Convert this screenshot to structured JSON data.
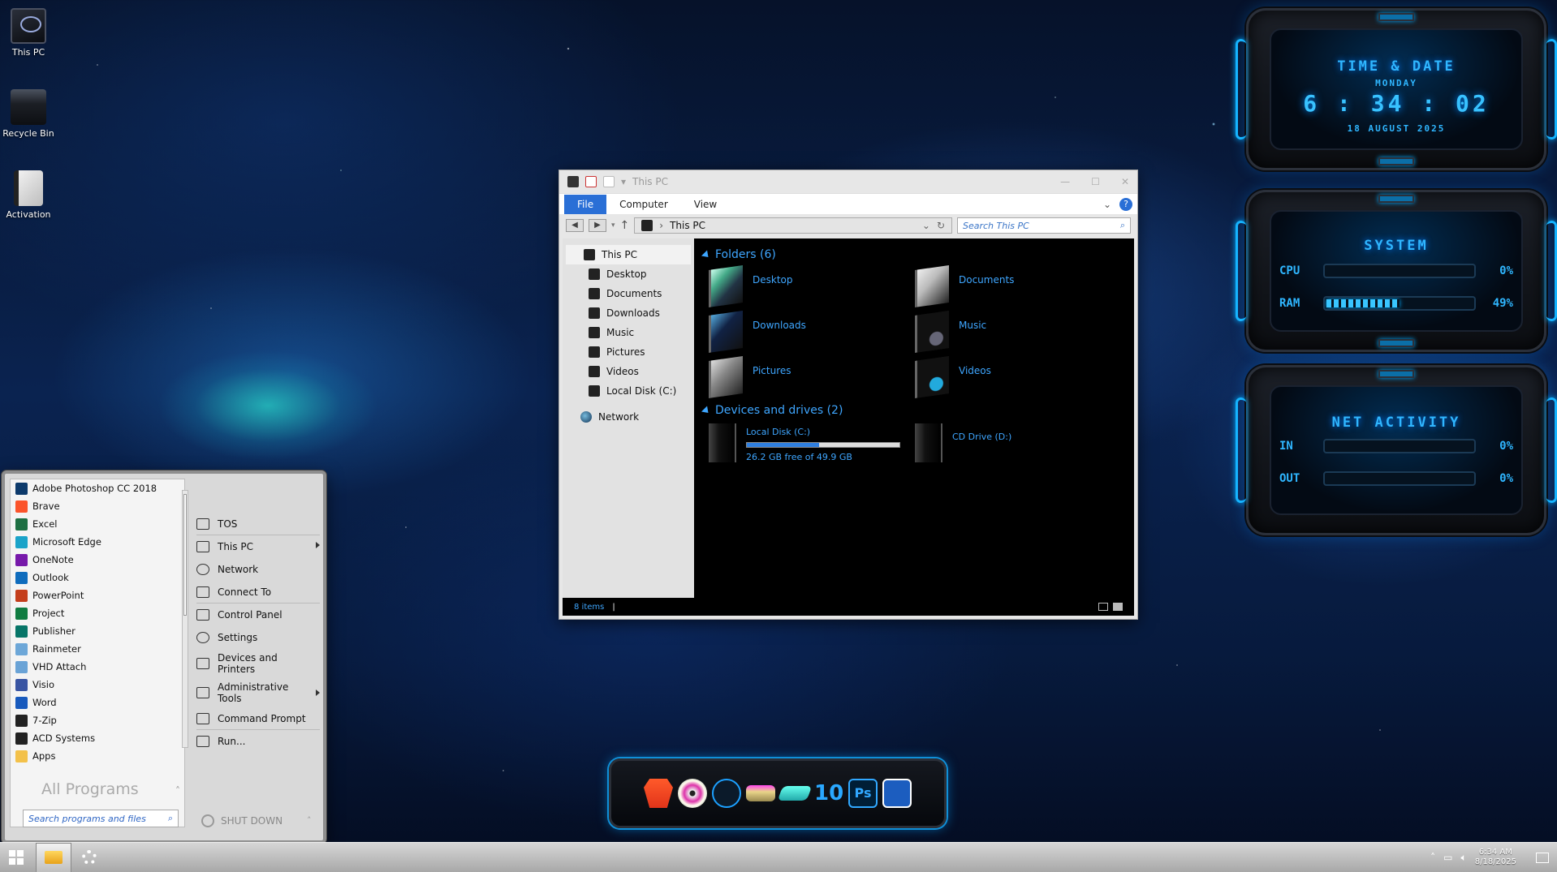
{
  "desktop_icons": [
    {
      "label": "This PC",
      "icon": "this-pc-icon"
    },
    {
      "label": "Recycle Bin",
      "icon": "recycle-bin-icon"
    },
    {
      "label": "Activation",
      "icon": "activation-icon"
    }
  ],
  "gadgets": {
    "time": {
      "title": "TIME & DATE",
      "day": "MONDAY",
      "time": "6 : 34 : 02",
      "date": "18 AUGUST 2025"
    },
    "system": {
      "title": "SYSTEM",
      "cpu_label": "CPU",
      "cpu_value": "0%",
      "cpu_level": 0,
      "ram_label": "RAM",
      "ram_value": "49%",
      "ram_level": 0.49
    },
    "net": {
      "title": "NET ACTIVITY",
      "in_label": "IN",
      "in_value": "0%",
      "out_label": "OUT",
      "out_value": "0%"
    }
  },
  "explorer": {
    "title": "This PC",
    "tabs": [
      "File",
      "Computer",
      "View"
    ],
    "address": "This PC",
    "search_placeholder": "Search This PC",
    "nav": {
      "top": "This PC",
      "children": [
        "Desktop",
        "Documents",
        "Downloads",
        "Music",
        "Pictures",
        "Videos",
        "Local Disk (C:)"
      ],
      "network": "Network"
    },
    "folders_header": "Folders (6)",
    "folders": [
      "Desktop",
      "Documents",
      "Downloads",
      "Music",
      "Pictures",
      "Videos"
    ],
    "drives_header": "Devices and drives (2)",
    "drives": [
      {
        "name": "Local Disk (C:)",
        "free": "26.2 GB free of 49.9 GB",
        "used_fraction": 0.475
      },
      {
        "name": "CD Drive (D:)"
      }
    ],
    "status": "8 items"
  },
  "start_menu": {
    "programs": [
      {
        "label": "Adobe Photoshop CC 2018",
        "color": "#0d3a6b"
      },
      {
        "label": "Brave",
        "color": "#fb542b"
      },
      {
        "label": "Excel",
        "color": "#1d6f42"
      },
      {
        "label": "Microsoft Edge",
        "color": "#1aa3c9"
      },
      {
        "label": "OneNote",
        "color": "#7719aa"
      },
      {
        "label": "Outlook",
        "color": "#0f6cbd"
      },
      {
        "label": "PowerPoint",
        "color": "#c43e1c"
      },
      {
        "label": "Project",
        "color": "#107c41"
      },
      {
        "label": "Publisher",
        "color": "#077568"
      },
      {
        "label": "Rainmeter",
        "color": "#6da7d8"
      },
      {
        "label": "VHD Attach",
        "color": "#6aa3d6"
      },
      {
        "label": "Visio",
        "color": "#3955a3"
      },
      {
        "label": "Word",
        "color": "#185abd"
      },
      {
        "label": "7-Zip",
        "color": "#222222"
      },
      {
        "label": "ACD Systems",
        "color": "#222222"
      },
      {
        "label": "Apps",
        "color": "#f3c14a"
      }
    ],
    "all_programs": "All Programs",
    "search_placeholder": "Search programs and files",
    "right": [
      "TOS",
      "This PC",
      "Network",
      "Connect To",
      "Control Panel",
      "Settings",
      "Devices and Printers",
      "Administrative Tools",
      "Command Prompt",
      "Run..."
    ],
    "shutdown": "SHUT DOWN"
  },
  "dock": [
    "brave",
    "dvd",
    "app-circle",
    "usb",
    "drive",
    "10",
    "Ps",
    "camera"
  ],
  "taskbar": {
    "time": "6:34 AM",
    "date": "8/18/2025"
  },
  "colors": {
    "accent": "#2fb6ff",
    "explorer_text": "#3ea6ff",
    "file_tab": "#2a6fd6"
  }
}
